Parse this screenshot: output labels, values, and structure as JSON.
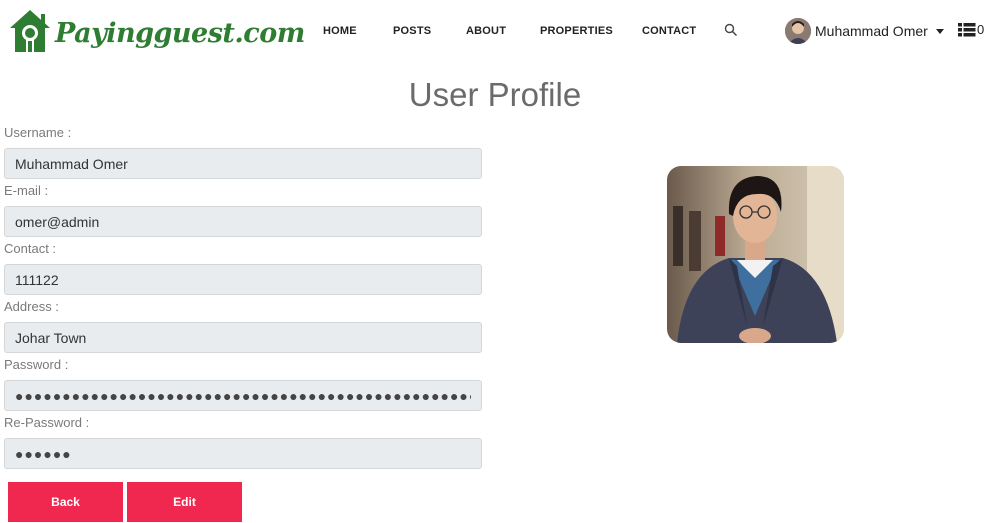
{
  "brand": {
    "name": "Payingguest.com",
    "color": "#2e7d32"
  },
  "nav": {
    "items": [
      {
        "label": "HOME"
      },
      {
        "label": "POSTS"
      },
      {
        "label": "ABOUT"
      },
      {
        "label": "PROPERTIES"
      },
      {
        "label": "CONTACT"
      }
    ],
    "search_icon": "search-icon",
    "user": {
      "name": "Muhammad Omer"
    },
    "cart": {
      "count": "0",
      "icon": "list-icon"
    }
  },
  "page": {
    "title": "User Profile"
  },
  "form": {
    "username": {
      "label": "Username :",
      "value": "Muhammad Omer"
    },
    "email": {
      "label": "E-mail :",
      "value": "omer@admin"
    },
    "contact": {
      "label": "Contact :",
      "value": "111122"
    },
    "address": {
      "label": "Address :",
      "value": "Johar Town"
    },
    "password": {
      "label": "Password :",
      "value": "●●●●●●●●●●●●●●●●●●●●●●●●●●●●●●●●●●●●●●●●●●●●●●●●●●●●●●●●●"
    },
    "repassword": {
      "label": "Re-Password :",
      "value": "●●●●●●"
    }
  },
  "buttons": {
    "back": "Back",
    "edit": "Edit"
  },
  "colors": {
    "accent": "#f0284f",
    "input_bg": "#e9ecef",
    "title": "#6b6b6b"
  }
}
